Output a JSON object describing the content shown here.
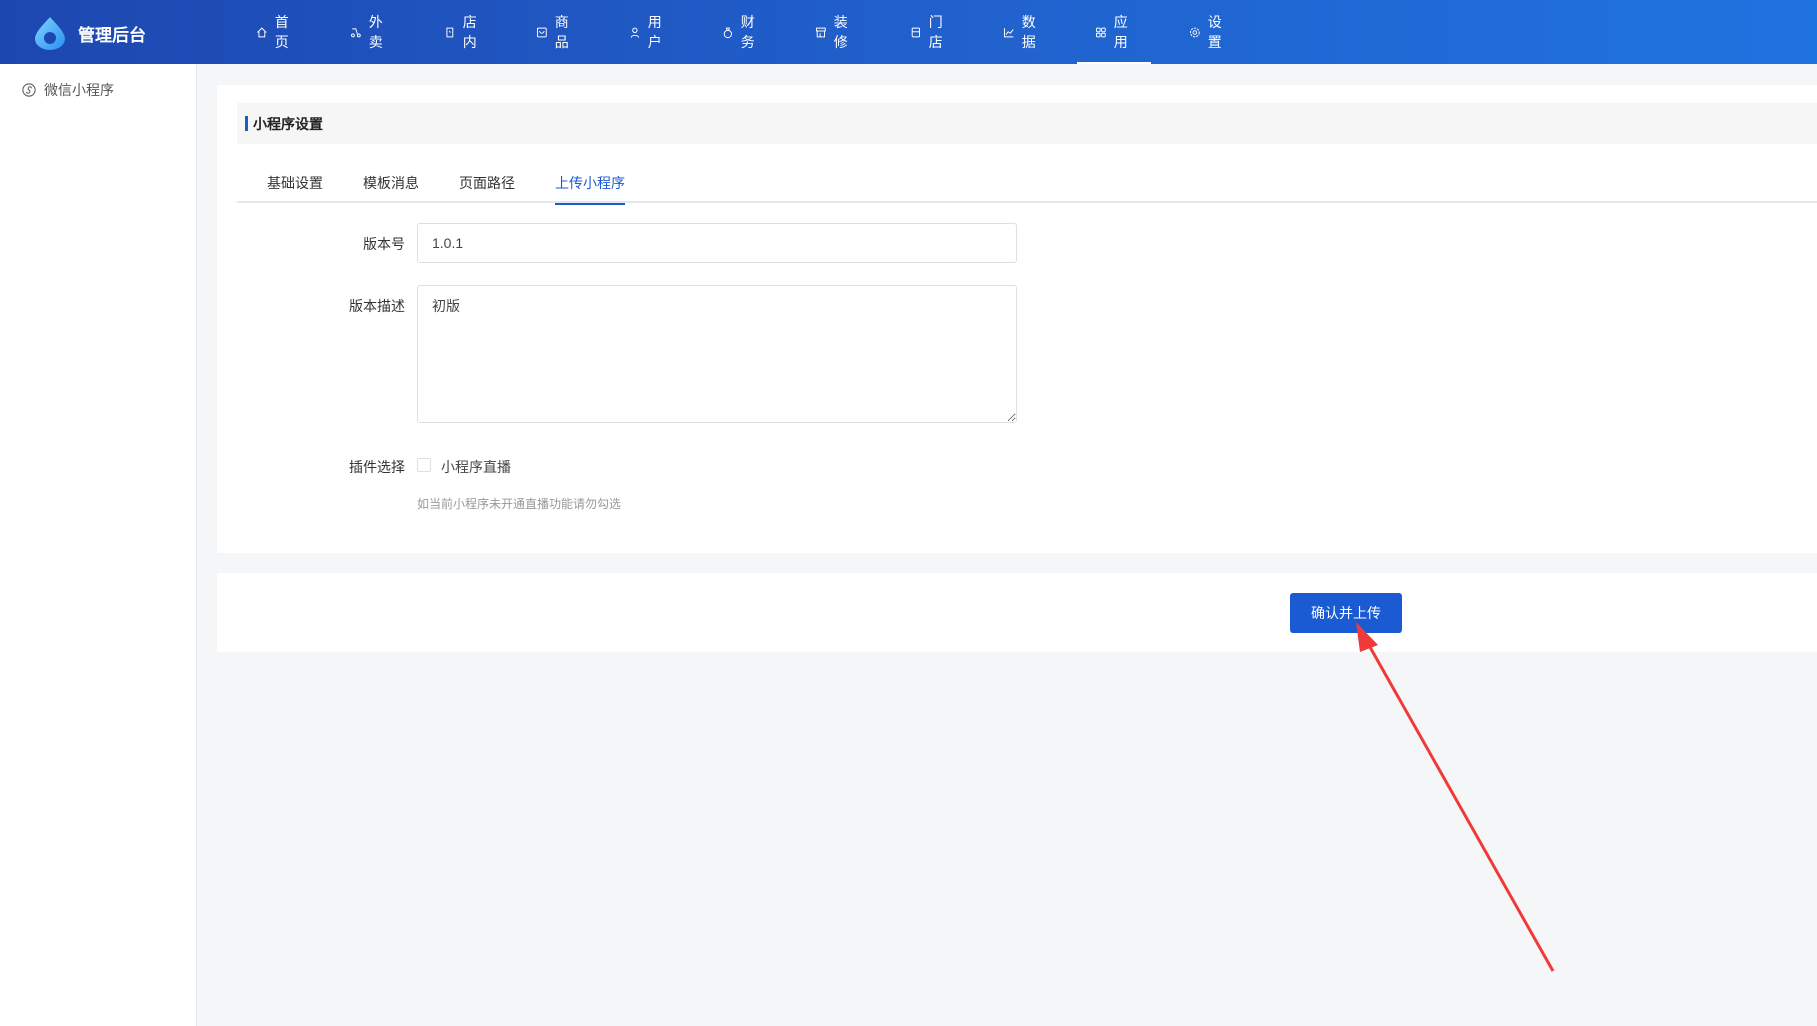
{
  "header": {
    "brand": "管理后台",
    "nav": [
      {
        "label": "首页",
        "icon": "home-icon"
      },
      {
        "label": "外卖",
        "icon": "delivery-icon"
      },
      {
        "label": "店内",
        "icon": "dine-in-icon"
      },
      {
        "label": "商品",
        "icon": "goods-icon"
      },
      {
        "label": "用户",
        "icon": "user-icon"
      },
      {
        "label": "财务",
        "icon": "money-bag-icon"
      },
      {
        "label": "装修",
        "icon": "storefront-icon"
      },
      {
        "label": "门店",
        "icon": "store-icon"
      },
      {
        "label": "数据",
        "icon": "chart-icon"
      },
      {
        "label": "应用",
        "icon": "apps-icon",
        "active": true
      },
      {
        "label": "设置",
        "icon": "gear-icon"
      }
    ]
  },
  "sidebar": {
    "items": [
      {
        "label": "微信小程序",
        "icon": "mini-program-icon"
      }
    ]
  },
  "section": {
    "title": "小程序设置"
  },
  "tabs": [
    {
      "label": "基础设置"
    },
    {
      "label": "模板消息"
    },
    {
      "label": "页面路径"
    },
    {
      "label": "上传小程序",
      "active": true
    }
  ],
  "form": {
    "version_label": "版本号",
    "version_value": "1.0.1",
    "desc_label": "版本描述",
    "desc_value": "初版",
    "plugin_label": "插件选择",
    "plugin_option": "小程序直播",
    "plugin_checked": false,
    "plugin_hint": "如当前小程序未开通直播功能请勿勾选"
  },
  "actions": {
    "submit_label": "确认并上传"
  },
  "colors": {
    "primary": "#1a5bd4",
    "annotation_arrow": "#f03a3a"
  }
}
